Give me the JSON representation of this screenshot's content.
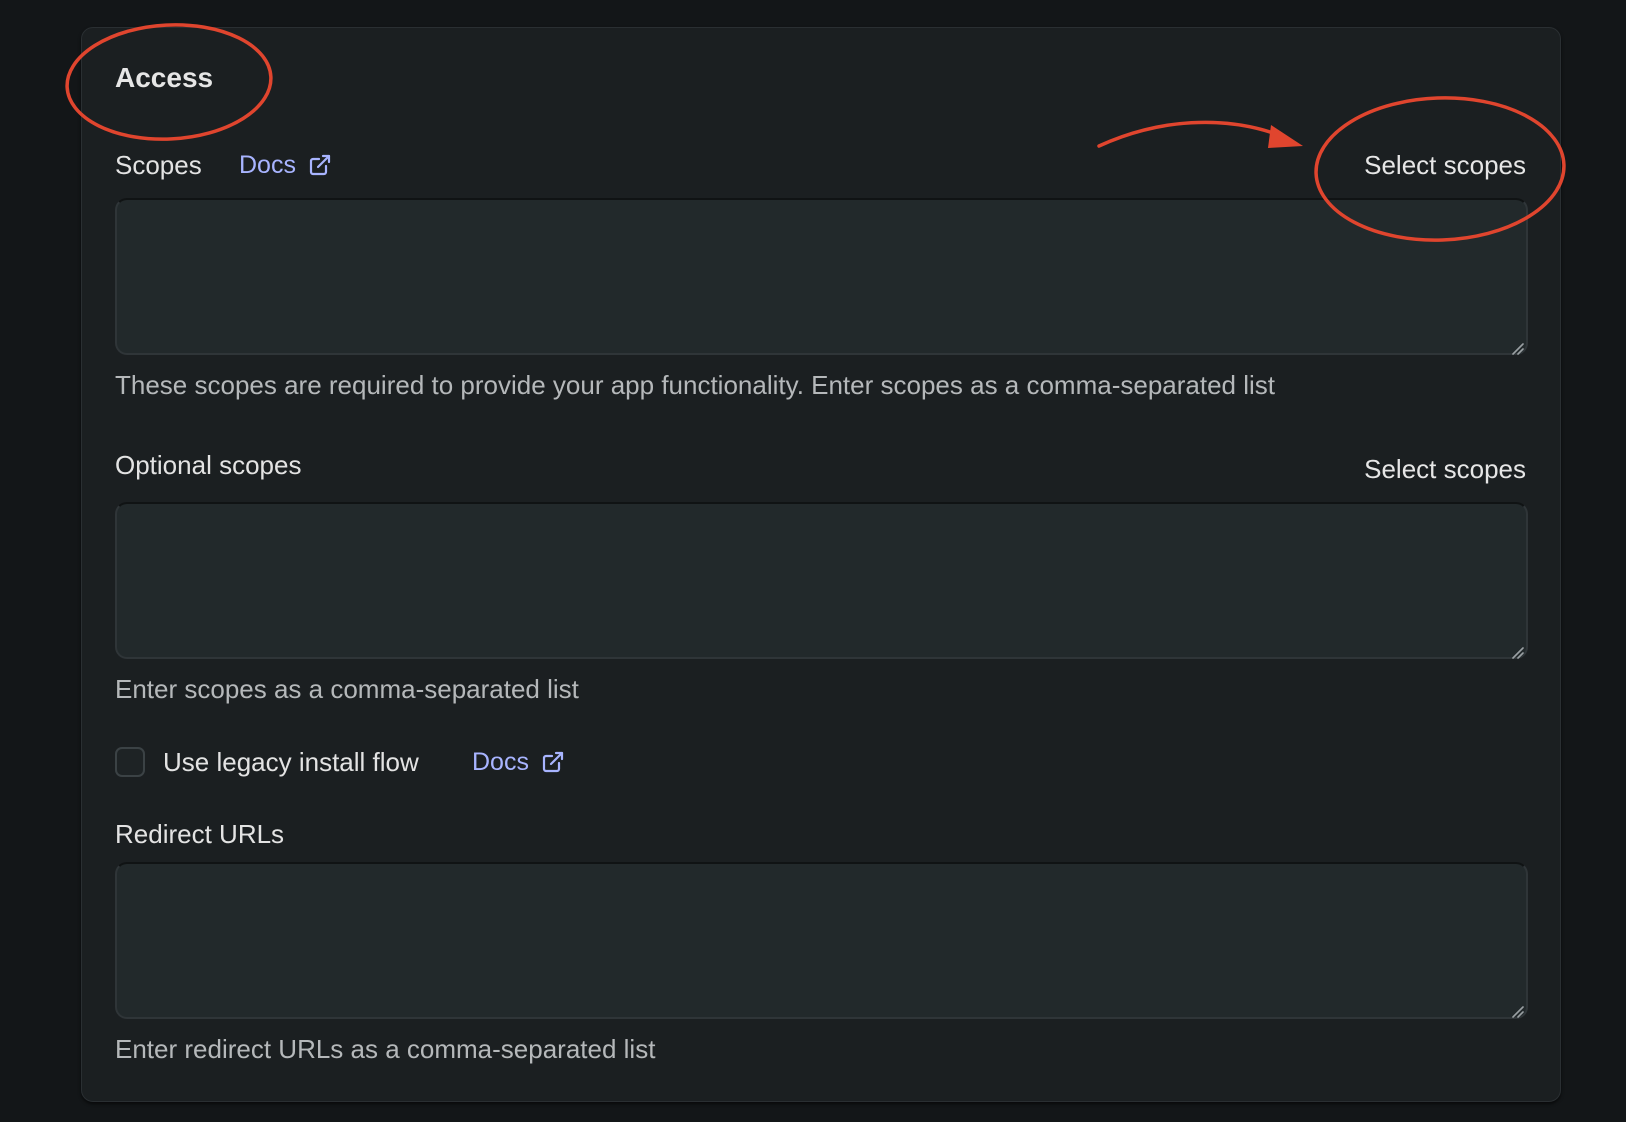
{
  "access": {
    "title": "Access"
  },
  "scopes": {
    "label": "Scopes",
    "docs_label": "Docs",
    "select_label": "Select scopes",
    "value": "",
    "help": "These scopes are required to provide your app functionality. Enter scopes as a comma-separated list"
  },
  "optional_scopes": {
    "label": "Optional scopes",
    "select_label": "Select scopes",
    "value": "",
    "help": "Enter scopes as a comma-separated list"
  },
  "legacy_install": {
    "label": "Use legacy install flow",
    "docs_label": "Docs",
    "checked": false
  },
  "redirect_urls": {
    "label": "Redirect URLs",
    "value": "",
    "help": "Enter redirect URLs as a comma-separated list"
  },
  "colors": {
    "background": "#131618",
    "card": "#1b1f21",
    "input": "#22292b",
    "link": "#a8b4ff",
    "annotation": "#e0452e"
  },
  "icons": {
    "external_link": "external-link-icon",
    "resize_handle": "resize-handle-icon"
  }
}
